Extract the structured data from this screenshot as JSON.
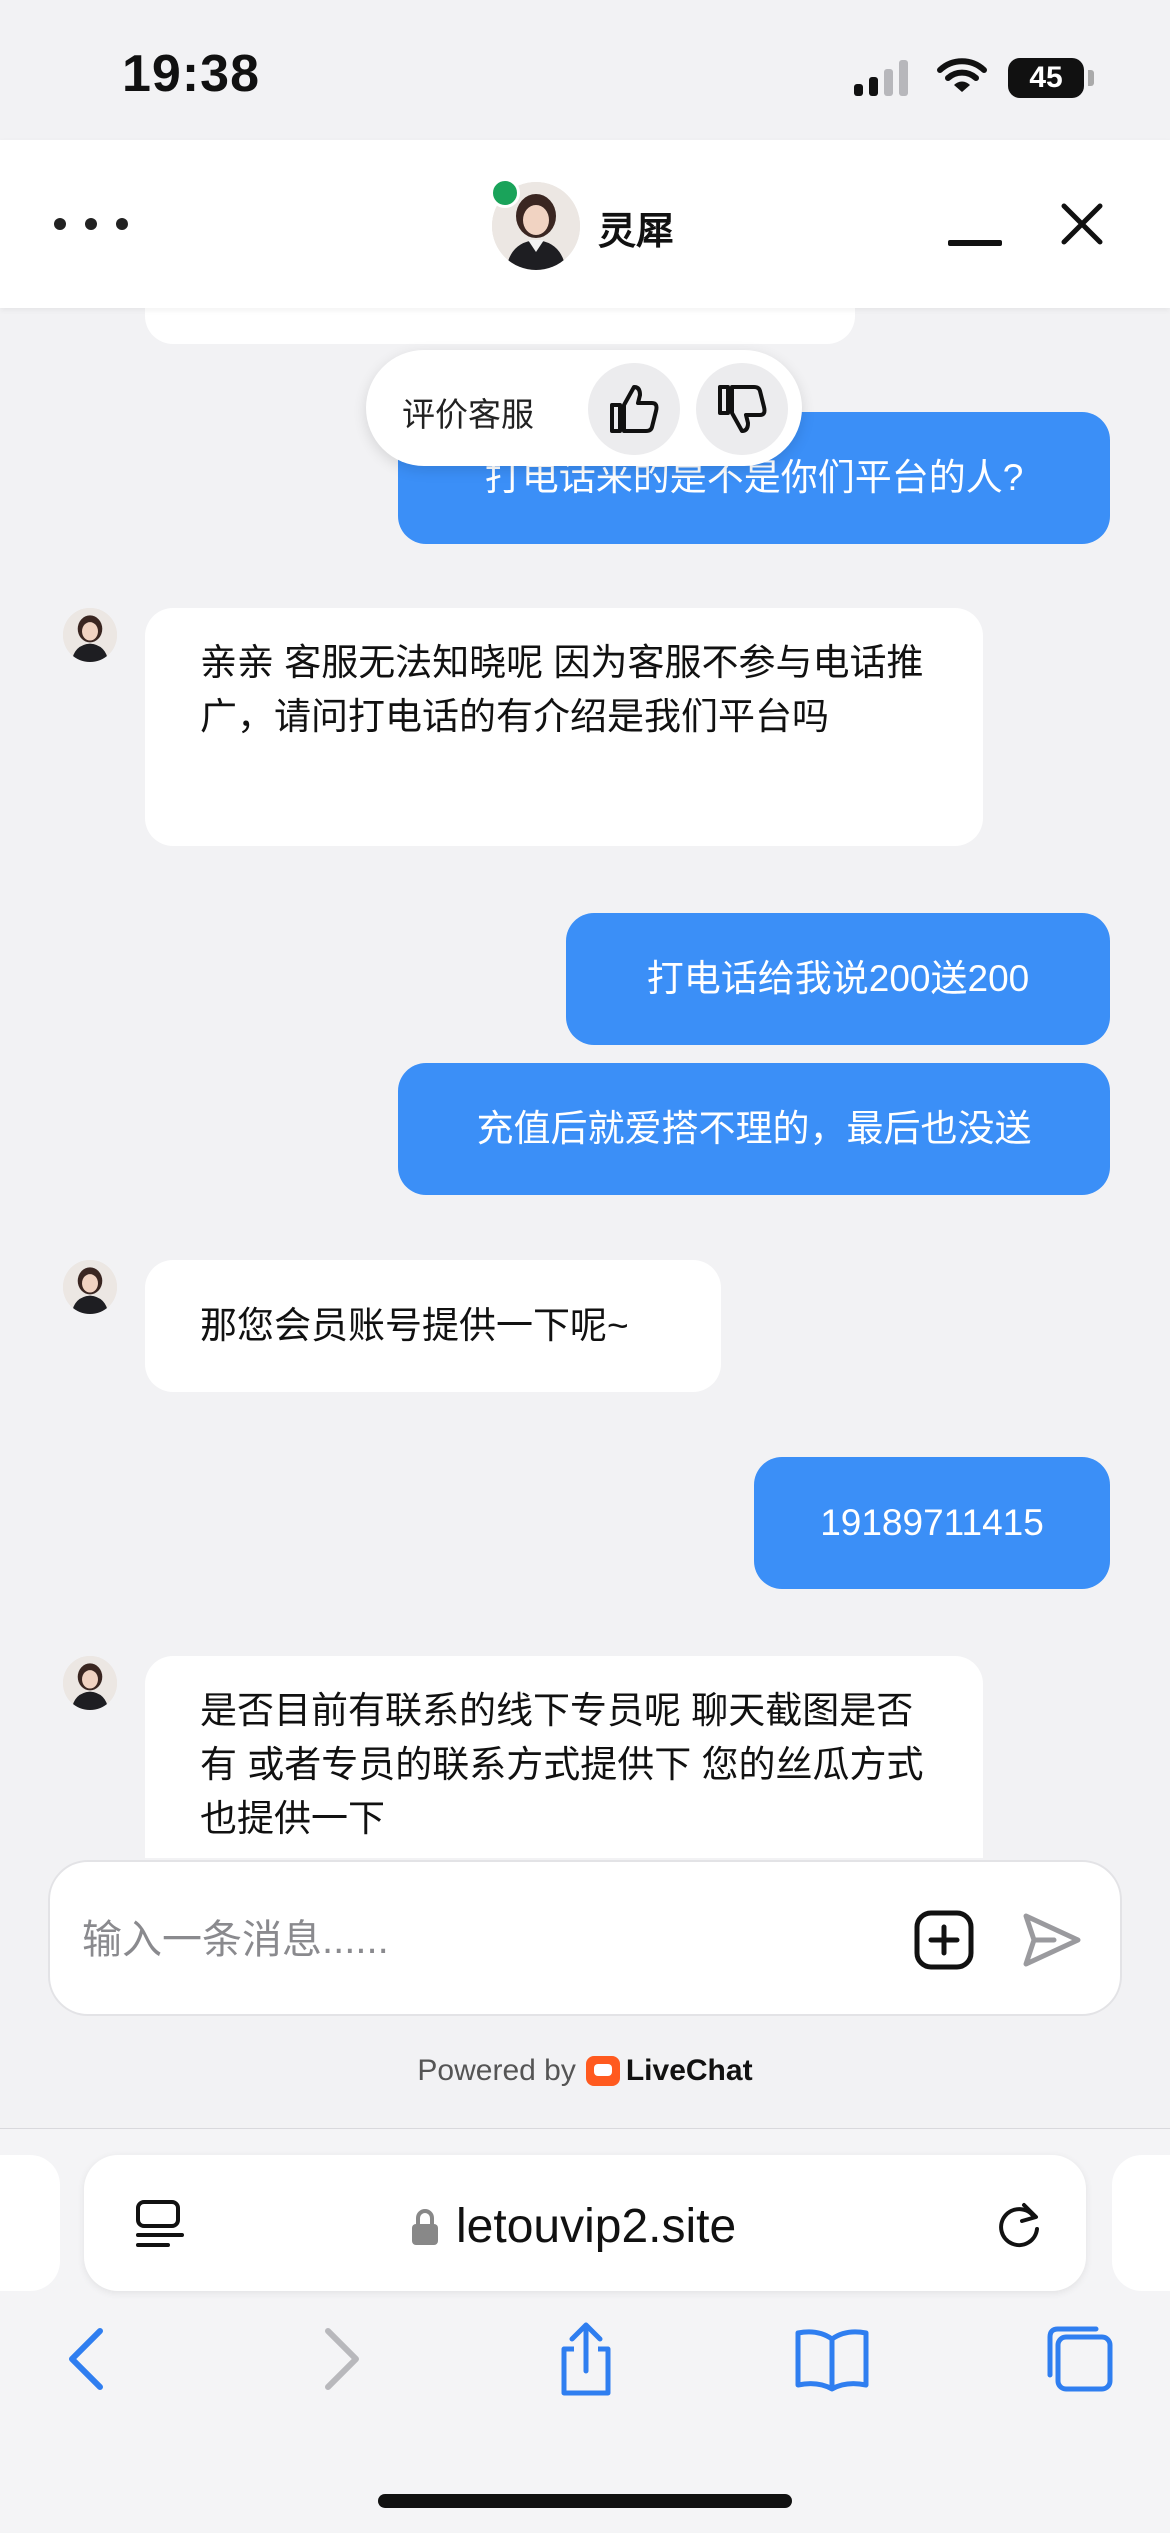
{
  "status_bar": {
    "time": "19:38",
    "battery": "45"
  },
  "header": {
    "agent_name": "灵犀"
  },
  "rating": {
    "label": "评价客服"
  },
  "messages": [
    {
      "from": "user",
      "text": "打电话来的是不是你们平台的人?"
    },
    {
      "from": "agent",
      "text": "亲亲 客服无法知晓呢 因为客服不参与电话推广，请问打电话的有介绍是我们平台吗"
    },
    {
      "from": "user",
      "text": "打电话给我说200送200"
    },
    {
      "from": "user",
      "text": "充值后就爱搭不理的，最后也没送"
    },
    {
      "from": "agent",
      "text": "那您会员账号提供一下呢~"
    },
    {
      "from": "user",
      "text": "19189711415"
    },
    {
      "from": "agent",
      "text": "是否目前有联系的线下专员呢 聊天截图是否有 或者专员的联系方式提供下 您的丝瓜方式也提供一下"
    }
  ],
  "composer": {
    "placeholder": "输入一条消息......"
  },
  "footer": {
    "powered_by": "Powered by",
    "brand": "LiveChat"
  },
  "browser": {
    "url": "letouvip2.site"
  },
  "colors": {
    "accent": "#3b8ff7",
    "online": "#1aa35a",
    "brand": "#ff5a1f"
  }
}
